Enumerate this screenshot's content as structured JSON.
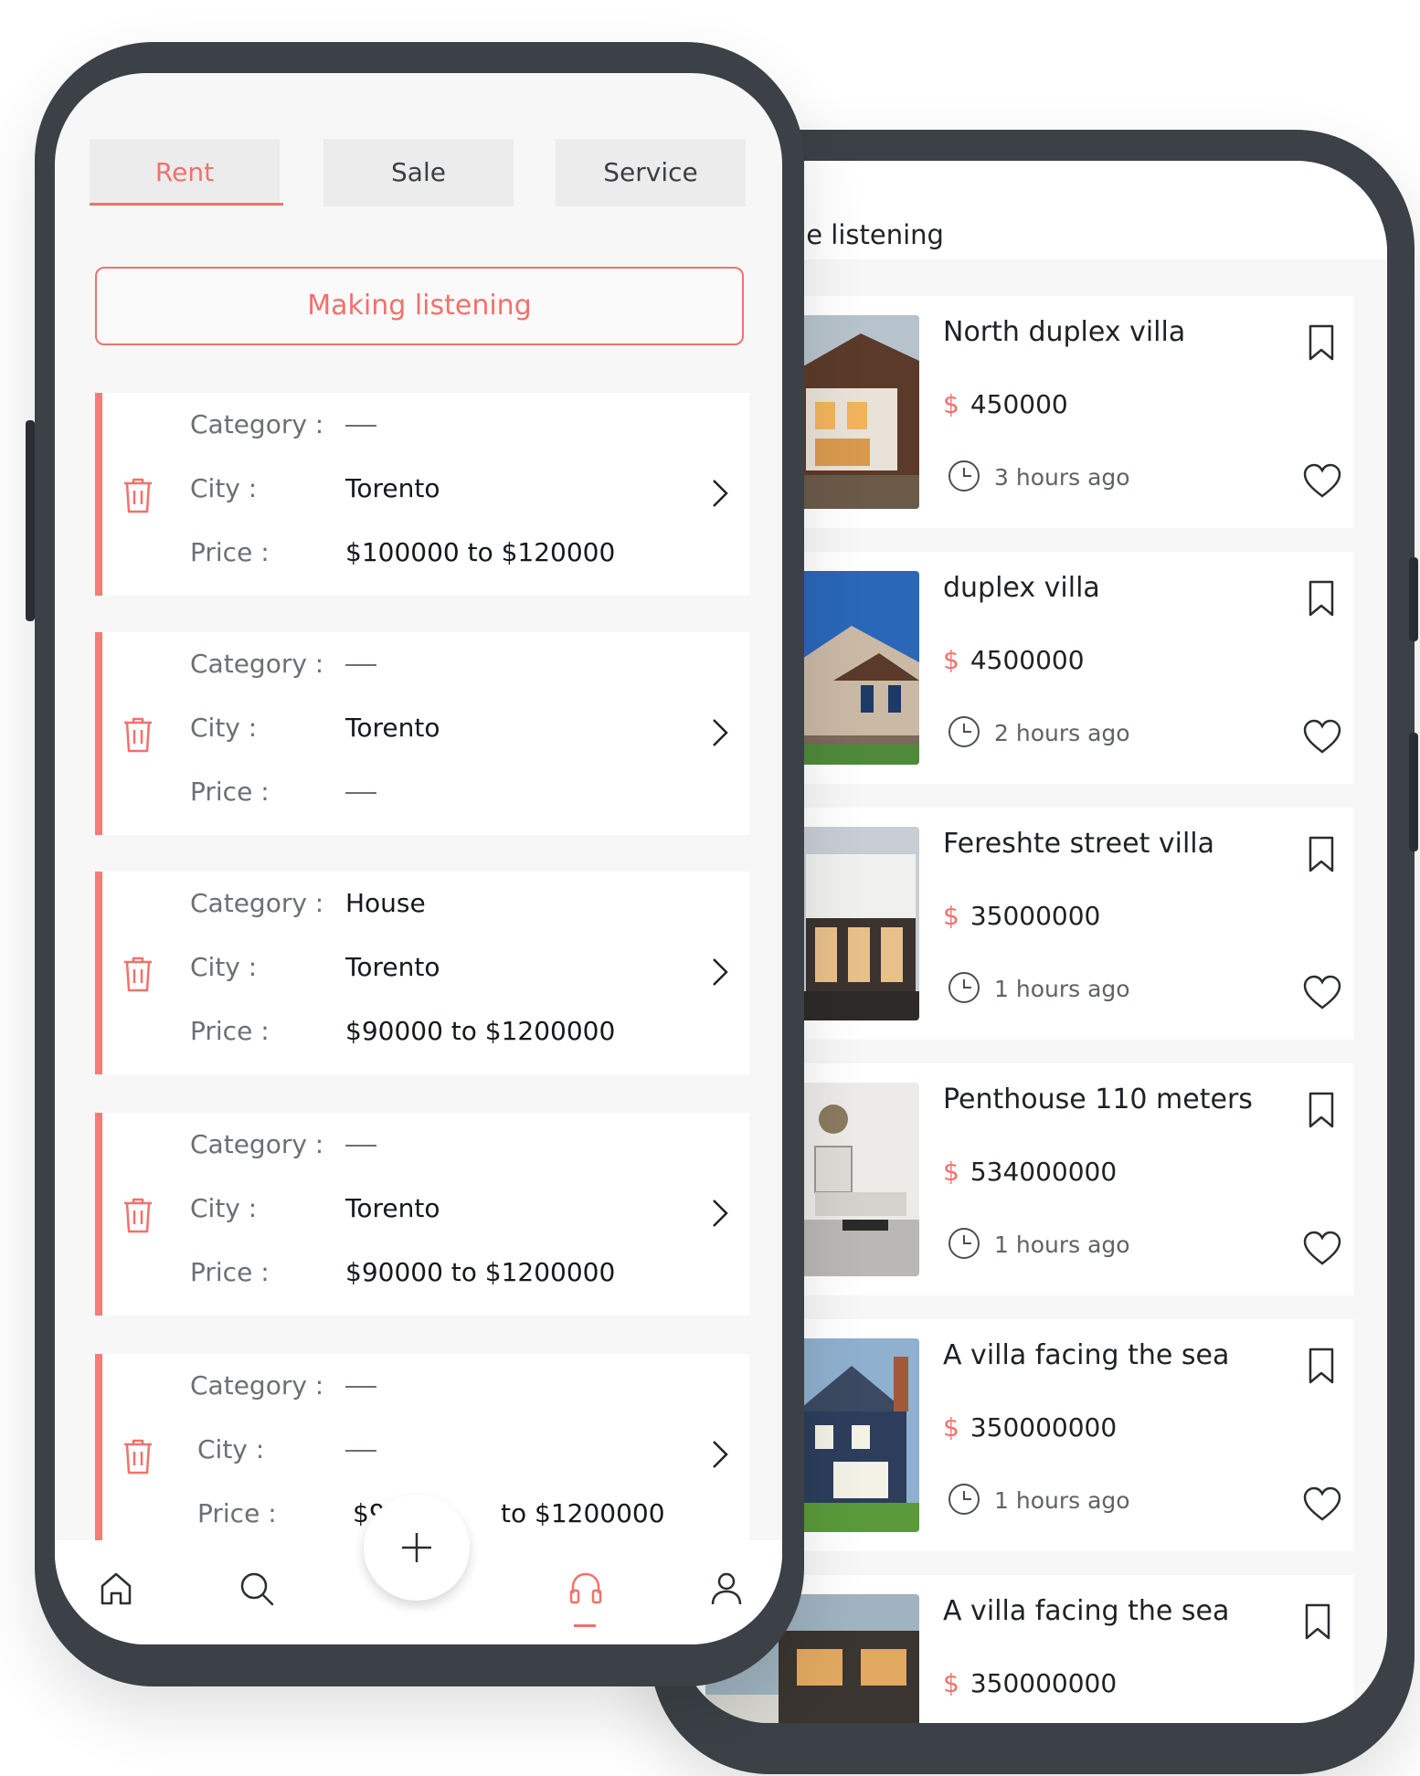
{
  "back_screen": {
    "title": "me listening",
    "listings": [
      {
        "title": "North duplex villa",
        "currency": "$",
        "price": "450000",
        "time": "3 hours ago"
      },
      {
        "title": "duplex villa",
        "currency": "$",
        "price": "4500000",
        "time": "2 hours ago"
      },
      {
        "title": "Fereshte street villa",
        "currency": "$",
        "price": "35000000",
        "time": "1 hours ago"
      },
      {
        "title": "Penthouse 110 meters",
        "currency": "$",
        "price": "534000000",
        "time": "1 hours ago"
      },
      {
        "title": "A villa facing the sea",
        "currency": "$",
        "price": "350000000",
        "time": "1 hours ago"
      },
      {
        "title": "A villa facing the sea",
        "currency": "$",
        "price": "350000000",
        "time": ""
      }
    ]
  },
  "front_screen": {
    "tabs": [
      {
        "label": "Rent"
      },
      {
        "label": "Sale"
      },
      {
        "label": "Service"
      }
    ],
    "active_tab": "Rent",
    "making_button": "Making listening",
    "labels": {
      "category": "Category :",
      "city": "City :",
      "price": "Price :"
    },
    "filters": [
      {
        "category": "",
        "city": "Torento",
        "price": "$100000  to  $120000"
      },
      {
        "category": "",
        "city": "Torento",
        "price": ""
      },
      {
        "category": "House",
        "city": "Torento",
        "price": "$90000  to  $1200000"
      },
      {
        "category": "",
        "city": "Torento",
        "price": "$90000  to  $1200000"
      },
      {
        "category": "",
        "city": "",
        "price_start": "$9",
        "price_end": "to  $1200000"
      }
    ],
    "bottom_nav": [
      "home-icon",
      "search-icon",
      "add-icon",
      "support-icon",
      "profile-icon"
    ],
    "active_nav": "support-icon"
  },
  "colors": {
    "accent": "#f2716b",
    "phone_frame": "#3b4146",
    "screen_bg": "#f7f7f7"
  }
}
